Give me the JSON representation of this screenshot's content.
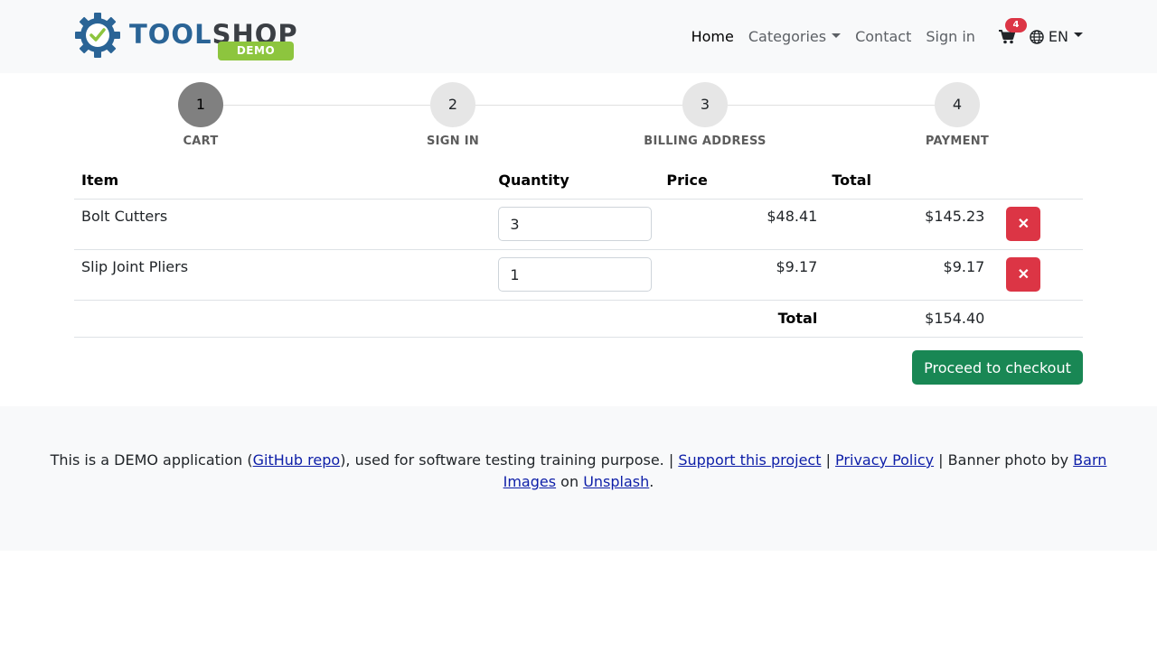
{
  "brand": {
    "name_part1": "TOOL",
    "name_part2": "SHOP",
    "badge": "DEMO"
  },
  "nav": {
    "home": "Home",
    "categories": "Categories",
    "contact": "Contact",
    "sign_in": "Sign in",
    "cart_count": "4",
    "language": "EN"
  },
  "steps": [
    {
      "number": "1",
      "label": "CART",
      "active": true
    },
    {
      "number": "2",
      "label": "SIGN IN",
      "active": false
    },
    {
      "number": "3",
      "label": "BILLING ADDRESS",
      "active": false
    },
    {
      "number": "4",
      "label": "PAYMENT",
      "active": false
    }
  ],
  "table": {
    "headers": {
      "item": "Item",
      "quantity": "Quantity",
      "price": "Price",
      "total": "Total"
    },
    "rows": [
      {
        "item": "Bolt Cutters",
        "quantity": "3",
        "price": "$48.41",
        "total": "$145.23"
      },
      {
        "item": "Slip Joint Pliers",
        "quantity": "1",
        "price": "$9.17",
        "total": "$9.17"
      }
    ],
    "grand_total_label": "Total",
    "grand_total": "$154.40",
    "delete_symbol": "✕"
  },
  "checkout_button": "Proceed to checkout",
  "footer": {
    "t1": "This is a DEMO application (",
    "github_link": "GitHub repo",
    "t2": "), used for software testing training purpose. | ",
    "support_link": "Support this project",
    "t3": " | ",
    "privacy_link": "Privacy Policy",
    "t4": " | Banner photo by ",
    "barn_link": "Barn Images",
    "t5": " on ",
    "unsplash_link": "Unsplash",
    "t6": "."
  },
  "colors": {
    "danger": "#dc3545",
    "success": "#198754",
    "brand_blue": "#2a6496",
    "brand_green": "#8dc53e"
  },
  "icons": {
    "logo": "gear-check-icon",
    "cart": "shopping-cart-icon",
    "language": "globe-icon",
    "delete": "close-icon"
  }
}
